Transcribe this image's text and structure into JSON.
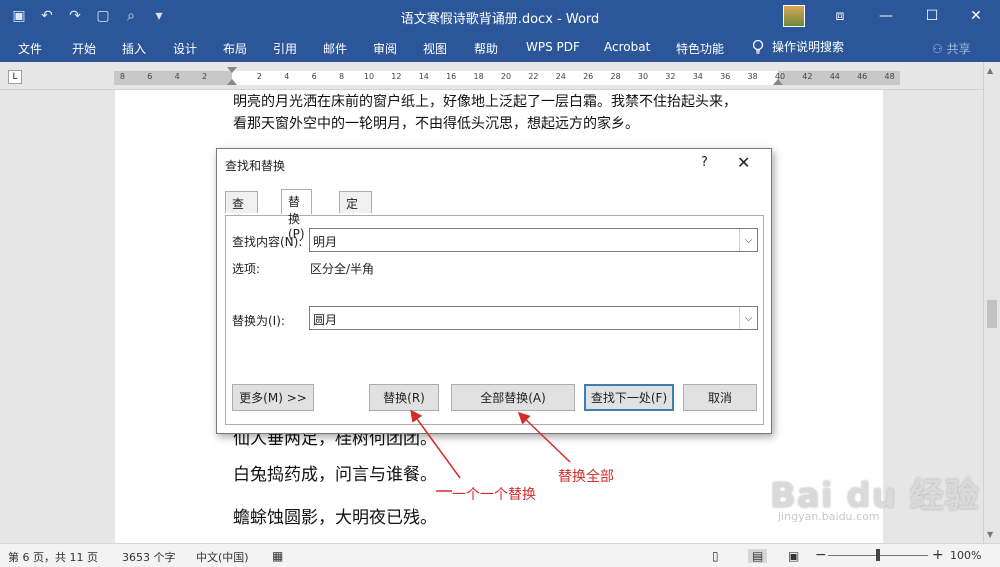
{
  "titlebar": {
    "doc_title": "语文寒假诗歌背诵册.docx - Word",
    "qat_icons": [
      "save-icon",
      "undo-icon",
      "redo-icon",
      "new-doc-icon",
      "print-preview-icon",
      "customize-icon"
    ],
    "qat_glyphs": [
      "▣",
      "↶",
      "↷",
      "▢",
      "⌕",
      "▾"
    ],
    "win_glyphs": {
      "restore_ribbon": "⧈",
      "minimize": "—",
      "maximize": "☐",
      "close": "✕"
    }
  },
  "menu": {
    "items": [
      "文件",
      "开始",
      "插入",
      "设计",
      "布局",
      "引用",
      "邮件",
      "审阅",
      "视图",
      "帮助",
      "WPS PDF",
      "Acrobat",
      "特色功能"
    ],
    "tell_me": "操作说明搜索",
    "share": "共享"
  },
  "ruler": {
    "left_numbers": [
      "8",
      "6",
      "4",
      "2"
    ],
    "right_numbers": [
      "2",
      "4",
      "6",
      "8",
      "10",
      "12",
      "14",
      "16",
      "18",
      "20",
      "22",
      "24",
      "26",
      "28",
      "30",
      "32",
      "34",
      "36",
      "38",
      "40",
      "42",
      "44",
      "46",
      "48"
    ],
    "tab_selector": "L"
  },
  "document": {
    "line1": "明亮的月光洒在床前的窗户纸上，好像地上泛起了一层白霜。我禁不住抬起头来，",
    "line2": "看那天窗外空中的一轮明月，不由得低头沉思，想起远方的家乡。",
    "line3": "仙人垂两足，桂树何团团。",
    "line4": "白兔捣药成，问言与谁餐。",
    "line5": "蟾蜍蚀圆影，大明夜已残。"
  },
  "dialog": {
    "title": "查找和替换",
    "help": "?",
    "close": "✕",
    "tabs": [
      "查找(D)",
      "替换(P)",
      "定位(G)"
    ],
    "active_tab": 1,
    "find_label": "查找内容(N):",
    "find_value": "明月",
    "options_label": "选项:",
    "options_value": "区分全/半角",
    "replace_label": "替换为(I):",
    "replace_value": "圆月",
    "buttons": {
      "more": "更多(M) >>",
      "replace": "替换(R)",
      "replace_all": "全部替换(A)",
      "find_next": "查找下一处(F)",
      "cancel": "取消"
    }
  },
  "annotations": {
    "replace_one": "一个一个替换",
    "replace_all": "替换全部",
    "color": "#d12d2d"
  },
  "watermark": {
    "logo": "Bai du 经验",
    "url": "jingyan.baidu.com"
  },
  "statusbar": {
    "page": "第 6 页，共 11 页",
    "words": "3653 个字",
    "language": "中文(中国)",
    "zoom": "100%",
    "zoom_minus": "−",
    "zoom_plus": "+"
  },
  "colors": {
    "ribbon": "#2b579a",
    "default_button_border": "#3c7fb1"
  }
}
